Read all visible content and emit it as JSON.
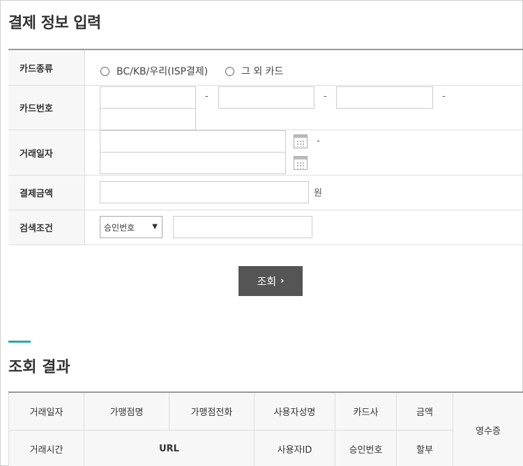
{
  "page_title": "결제 정보 입력",
  "form": {
    "card_type_label": "카드종류",
    "card_type_options": [
      "BC/KB/우리(ISP결제)",
      "그 외 카드"
    ],
    "card_number_label": "카드번호",
    "dash": "-",
    "trade_date_label": "거래일자",
    "amount_label": "결제금액",
    "amount_unit": "원",
    "search_cond_label": "검색조건",
    "search_cond_selected": "승인번호"
  },
  "search_button": "조회",
  "result_title": "조회 결과",
  "result_table": {
    "row1": [
      "거래일자",
      "가맹점명",
      "가맹점전화",
      "사용자성명",
      "카드사",
      "금액"
    ],
    "receipt": "영수증",
    "row2": [
      "거래시간",
      "URL",
      "사용자ID",
      "승인번호",
      "할부"
    ]
  },
  "icons": {
    "calendar": "calendar-icon",
    "chevron": "chevron-right-icon",
    "dropdown": "chevron-down-icon"
  },
  "colors": {
    "button_bg": "#555555",
    "accent": "#2aa6a6",
    "header_bg": "#f7f7f7"
  }
}
